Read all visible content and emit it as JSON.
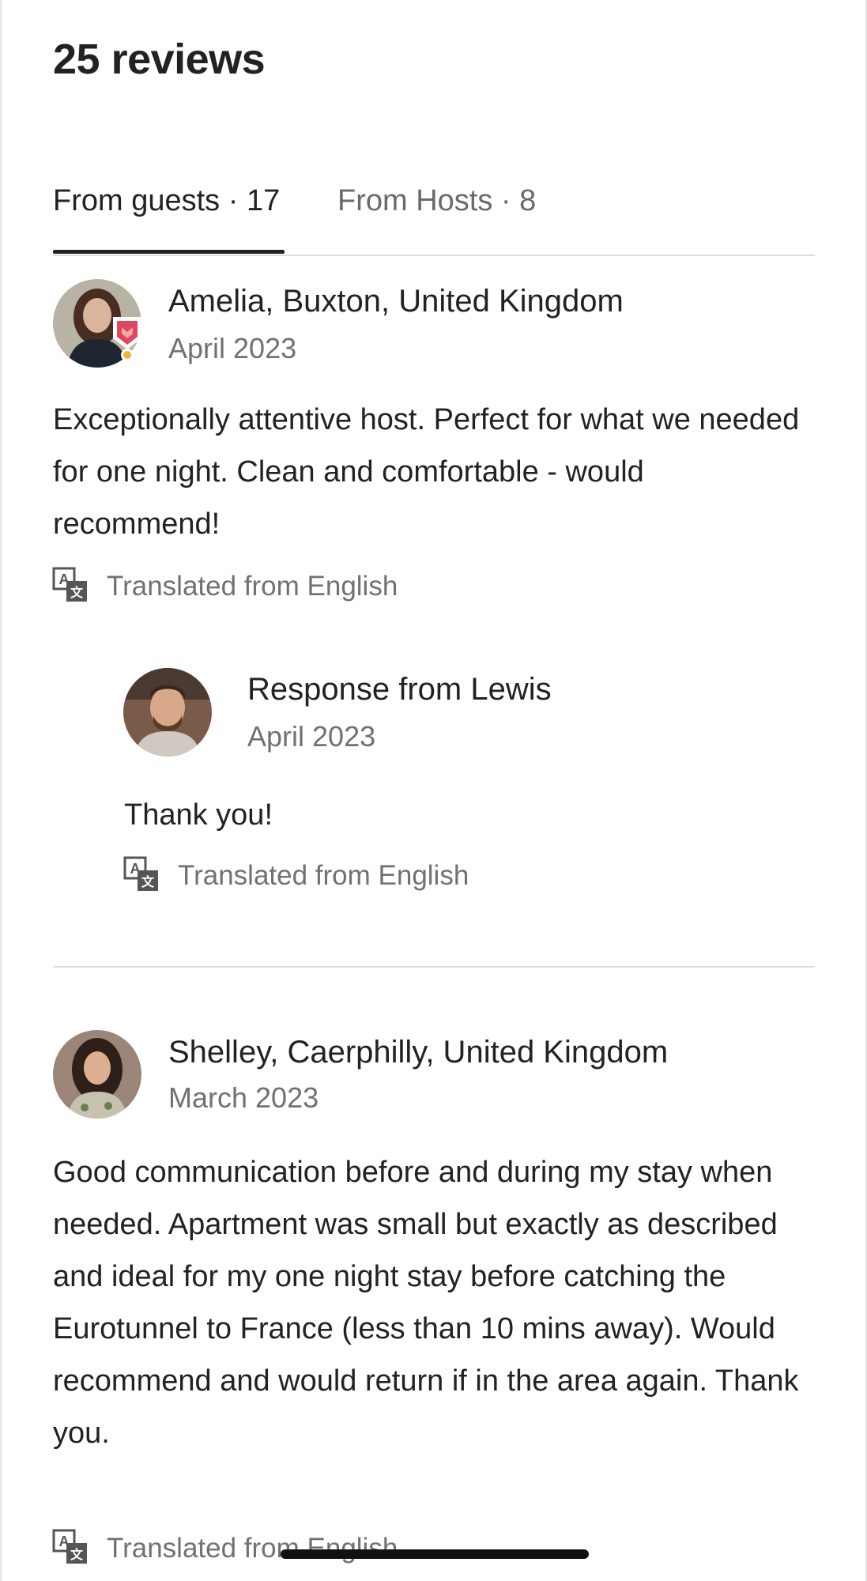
{
  "header": {
    "title": "25 reviews"
  },
  "tabs": [
    {
      "label": "From guests · 17",
      "selected": true
    },
    {
      "label": "From Hosts · 8",
      "selected": false
    }
  ],
  "reviews": [
    {
      "name": "Amelia, Buxton, United Kingdom",
      "date": "April 2023",
      "text": "Exceptionally attentive host. Perfect for what we needed for one night. Clean and comfortable - would recommend!",
      "translated": "Translated from English",
      "response": {
        "name": "Response from Lewis",
        "date": "April 2023",
        "text": "Thank you!",
        "translated": "Translated from English"
      }
    },
    {
      "name": "Shelley, Caerphilly, United Kingdom",
      "date": "March 2023",
      "text": "Good communication before and during my stay when needed. Apartment was small but exactly as described and ideal for my one night stay before catching the Eurotunnel to France (less than 10 mins away). Would recommend and would return if in the area again. Thank you.",
      "translated": "Translated from English"
    }
  ],
  "colors": {
    "text_primary": "#222222",
    "text_secondary": "#717171",
    "divider": "#dddddd",
    "badge_red": "#e0465e"
  }
}
